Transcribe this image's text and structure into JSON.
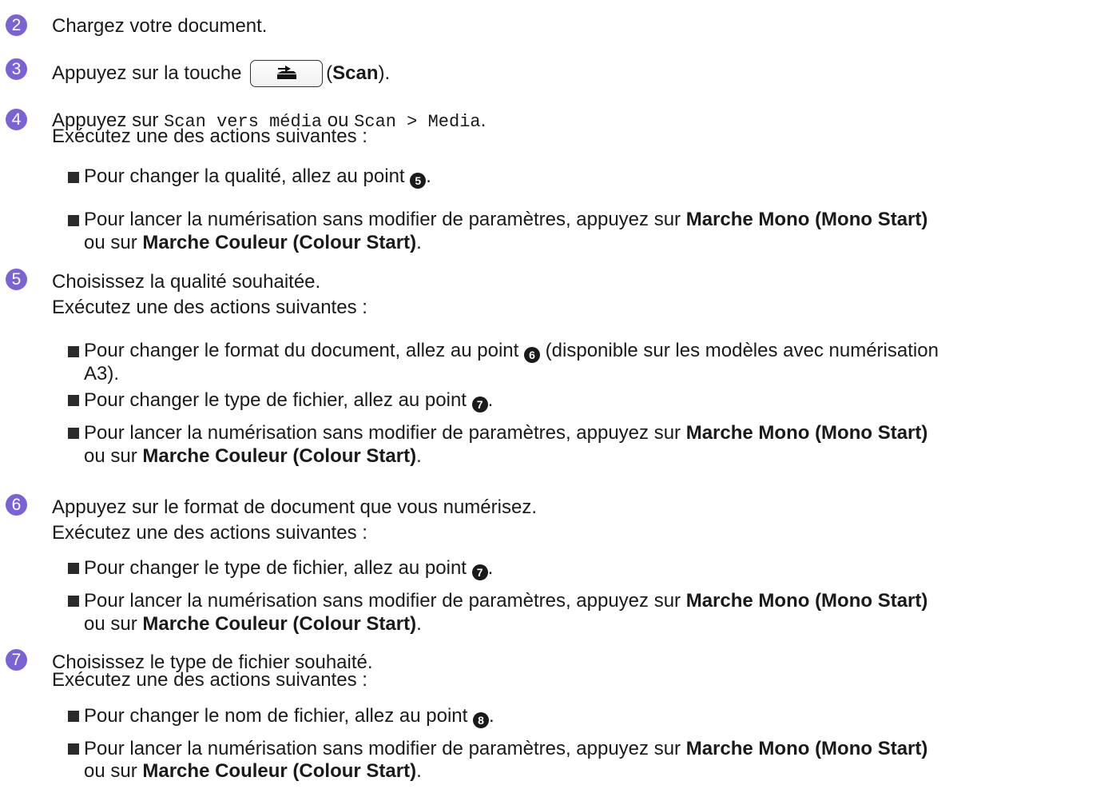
{
  "steps": [
    {
      "num": "2",
      "text": "Chargez votre document."
    },
    {
      "num": "3",
      "pre": "Appuyez sur la touche",
      "key_icon": "scan-icon",
      "paren_open": "(",
      "key_label": "Scan",
      "paren_close": ")."
    },
    {
      "num": "4",
      "pre": "Appuyez sur",
      "opt1": "Scan vers média",
      "mid": "ou",
      "opt2": "Scan > Media",
      "post": ".",
      "line2": "Exécutez une des actions suivantes :",
      "bullets": [
        {
          "text": "Pour changer la qualité, allez au point",
          "ref": "5",
          "end": "."
        },
        {
          "text": "Pour lancer la numérisation sans modifier de paramètres, appuyez sur",
          "bold1": "Marche Mono (Mono Start)",
          "cont": "ou sur",
          "bold2": "Marche Couleur (Colour Start)",
          "end": "."
        }
      ]
    },
    {
      "num": "5",
      "text": "Choisissez la qualité souhaitée.",
      "line2": "Exécutez une des actions suivantes :",
      "bullets": [
        {
          "text": "Pour changer le format du document, allez au point",
          "ref": "6",
          "after": "(disponible sur les modèles avec numérisation",
          "cont": "A3)."
        },
        {
          "text": "Pour changer le type de fichier, allez au point",
          "ref": "7",
          "end": "."
        },
        {
          "text": "Pour lancer la numérisation sans modifier de paramètres, appuyez sur",
          "bold1": "Marche Mono (Mono Start)",
          "cont": "ou sur",
          "bold2": "Marche Couleur (Colour Start)",
          "end": "."
        }
      ]
    },
    {
      "num": "6",
      "text": "Appuyez sur le format de document que vous numérisez.",
      "line2": "Exécutez une des actions suivantes :",
      "bullets": [
        {
          "text": "Pour changer le type de fichier, allez au point",
          "ref": "7",
          "end": "."
        },
        {
          "text": "Pour lancer la numérisation sans modifier de paramètres, appuyez sur",
          "bold1": "Marche Mono (Mono Start)",
          "cont": "ou sur",
          "bold2": "Marche Couleur (Colour Start)",
          "end": "."
        }
      ]
    },
    {
      "num": "7",
      "text": "Choisissez le type de fichier souhaité.",
      "line2": "Exécutez une des actions suivantes :",
      "bullets": [
        {
          "text": "Pour changer le nom de fichier, allez au point",
          "ref": "8",
          "end": "."
        },
        {
          "text": "Pour lancer la numérisation sans modifier de paramètres, appuyez sur",
          "bold1": "Marche Mono (Mono Start)",
          "cont": "ou sur",
          "bold2": "Marche Couleur (Colour Start)",
          "end": "."
        }
      ]
    }
  ],
  "colors": {
    "step_badge": "#7b63d6",
    "text": "#1a1a1a"
  }
}
